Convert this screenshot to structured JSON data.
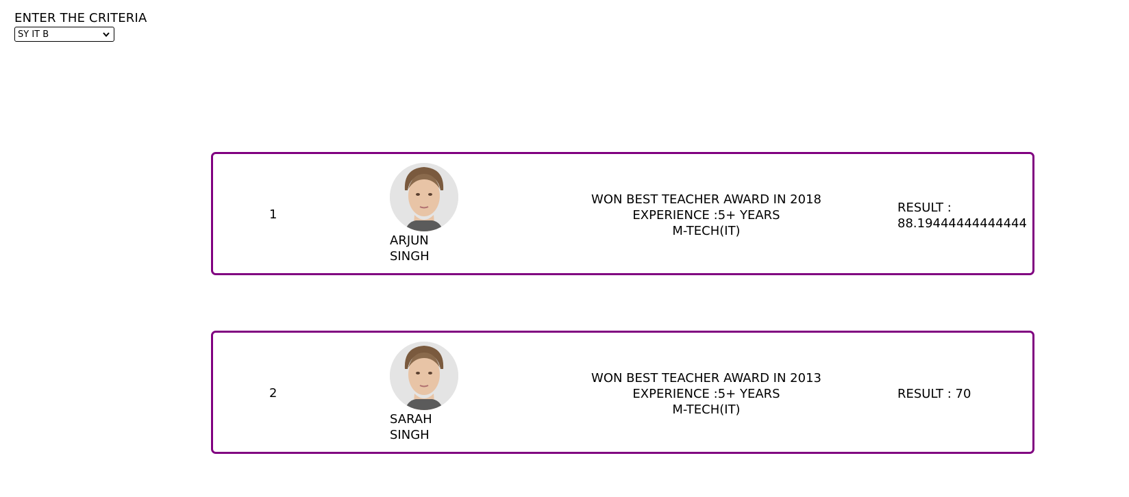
{
  "criteria": {
    "label": "ENTER THE CRITERIA",
    "selected": "SY IT B"
  },
  "colors": {
    "card_border": "#800080",
    "avatar_bg": "#e4e4e4"
  },
  "teachers": [
    {
      "rank": "1",
      "first_name": "ARJUN",
      "last_name": "SINGH",
      "award": "WON BEST TEACHER AWARD IN 2018",
      "experience": "EXPERIENCE :5+ YEARS",
      "qualification": "M-TECH(IT)",
      "result_label": "RESULT :",
      "result_value": "88.19444444444444"
    },
    {
      "rank": "2",
      "first_name": "SARAH",
      "last_name": "SINGH",
      "award": "WON BEST TEACHER AWARD IN 2013",
      "experience": "EXPERIENCE :5+ YEARS",
      "qualification": "M-TECH(IT)",
      "result_label": "RESULT : 70",
      "result_value": ""
    }
  ],
  "icons": {
    "dropdown": "chevron-down-icon",
    "photo": "avatar"
  }
}
